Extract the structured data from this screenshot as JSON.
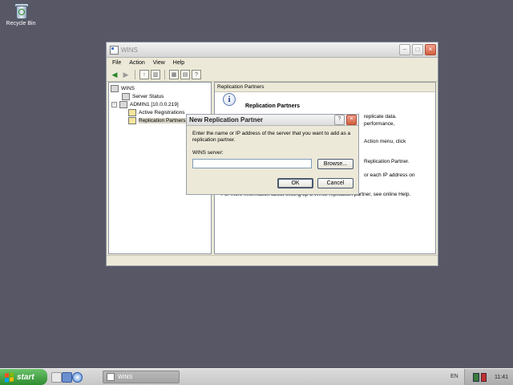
{
  "desktop": {
    "recycle_bin_label": "Recycle Bin"
  },
  "window": {
    "title": "WINS",
    "menu": [
      "File",
      "Action",
      "View",
      "Help"
    ],
    "tree": {
      "root": "WINS",
      "server_status": "Server Status",
      "server": "ADMIN1 [10.0.0.219]",
      "active_registrations": "Active Registrations",
      "replication_partners": "Replication Partners"
    },
    "detail": {
      "header": "Replication Partners",
      "title": "Replication Partners",
      "fragments": [
        "replicate data.",
        "performance,",
        "Action menu, click",
        "Replication Partner.",
        "or each IP address on"
      ],
      "help_line": "For more information about setting up a WINS replication partner, see online Help."
    }
  },
  "dialog": {
    "title": "New Replication Partner",
    "instructions": "Enter the name or IP address of the server that you want to add as a replication partner.",
    "label": "WINS server:",
    "input_value": "",
    "browse": "Browse...",
    "ok": "OK",
    "cancel": "Cancel"
  },
  "taskbar": {
    "start": "start",
    "task": "WINS",
    "lang": "EN",
    "clock": "11:41"
  }
}
